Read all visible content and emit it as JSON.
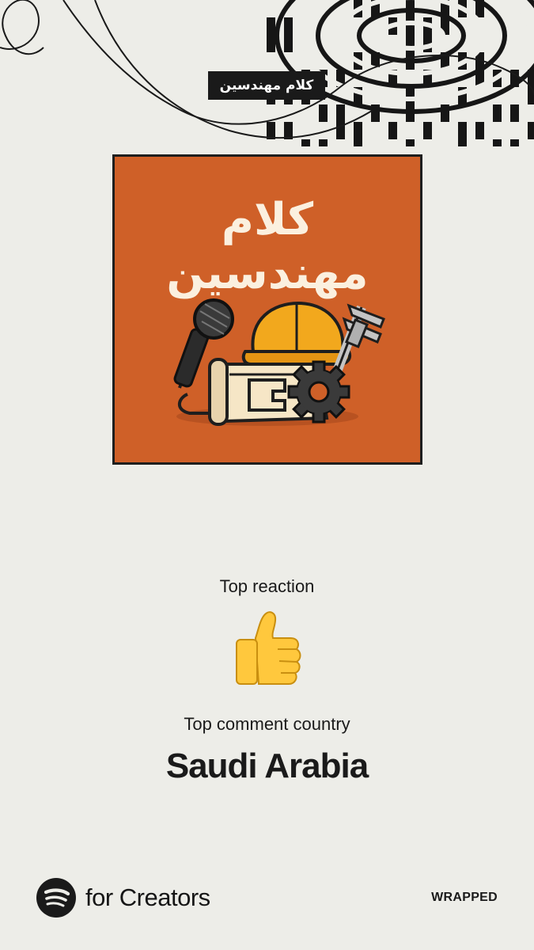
{
  "podcast": {
    "title_tag": "كلام مهندسين",
    "cover_line1": "كلام",
    "cover_line2": "مهندسين"
  },
  "stats": {
    "top_reaction_label": "Top reaction",
    "top_reaction_emoji": "thumbs-up",
    "top_comment_country_label": "Top comment country",
    "top_comment_country": "Saudi Arabia"
  },
  "footer": {
    "brand_text": "for Creators",
    "wrapped_label": "WRAPPED"
  },
  "colors": {
    "background": "#edede8",
    "cover_orange": "#cf6028",
    "ink": "#161616",
    "cover_text": "#fbf0df"
  },
  "icons": [
    "spotify-logo-icon",
    "thumbs-up-icon",
    "microphone-icon",
    "hard-hat-icon",
    "blueprint-icon",
    "gear-icon",
    "caliper-icon"
  ]
}
